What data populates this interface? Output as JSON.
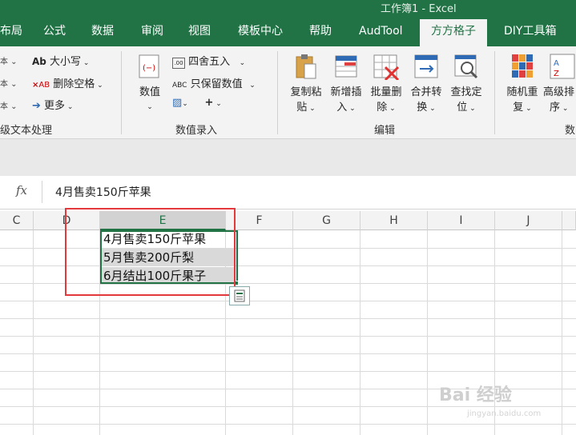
{
  "window": {
    "title": "工作簿1 - Excel"
  },
  "tabs": [
    {
      "label": "布局"
    },
    {
      "label": "公式"
    },
    {
      "label": "数据"
    },
    {
      "label": "审阅"
    },
    {
      "label": "视图"
    },
    {
      "label": "模板中心"
    },
    {
      "label": "帮助"
    },
    {
      "label": "AudTool"
    },
    {
      "label": "方方格子"
    },
    {
      "label": "DIY工具箱"
    }
  ],
  "ribbon": {
    "text_group": {
      "items": [
        "大小写",
        "删除空格",
        "更多"
      ],
      "label": "级文本处理"
    },
    "number_group": {
      "big_button": "数值",
      "items": [
        "四舍五入",
        "只保留数值"
      ],
      "label": "数值录入"
    },
    "edit_group": {
      "buttons": [
        {
          "line1": "复制粘",
          "line2": "贴"
        },
        {
          "line1": "新增插",
          "line2": "入"
        },
        {
          "line1": "批量删",
          "line2": "除"
        },
        {
          "line1": "合并转",
          "line2": "换"
        },
        {
          "line1": "查找定",
          "line2": "位"
        }
      ],
      "label": "编辑"
    },
    "more_group": {
      "buttons": [
        {
          "line1": "随机重",
          "line2": "复"
        },
        {
          "line1": "高级排",
          "line2": "序"
        }
      ],
      "label": "数"
    }
  },
  "formula_bar": {
    "fx": "fx",
    "content": "4月售卖150斤苹果"
  },
  "columns": [
    "C",
    "D",
    "E",
    "F",
    "G",
    "H",
    "I",
    "J"
  ],
  "cells": {
    "E1": "4月售卖150斤苹果",
    "E2": "5月售卖200斤梨",
    "E3": "6月结出100斤果子"
  },
  "watermark": {
    "main": "Bai 经验",
    "sub": "jingyan.baidu.com"
  }
}
